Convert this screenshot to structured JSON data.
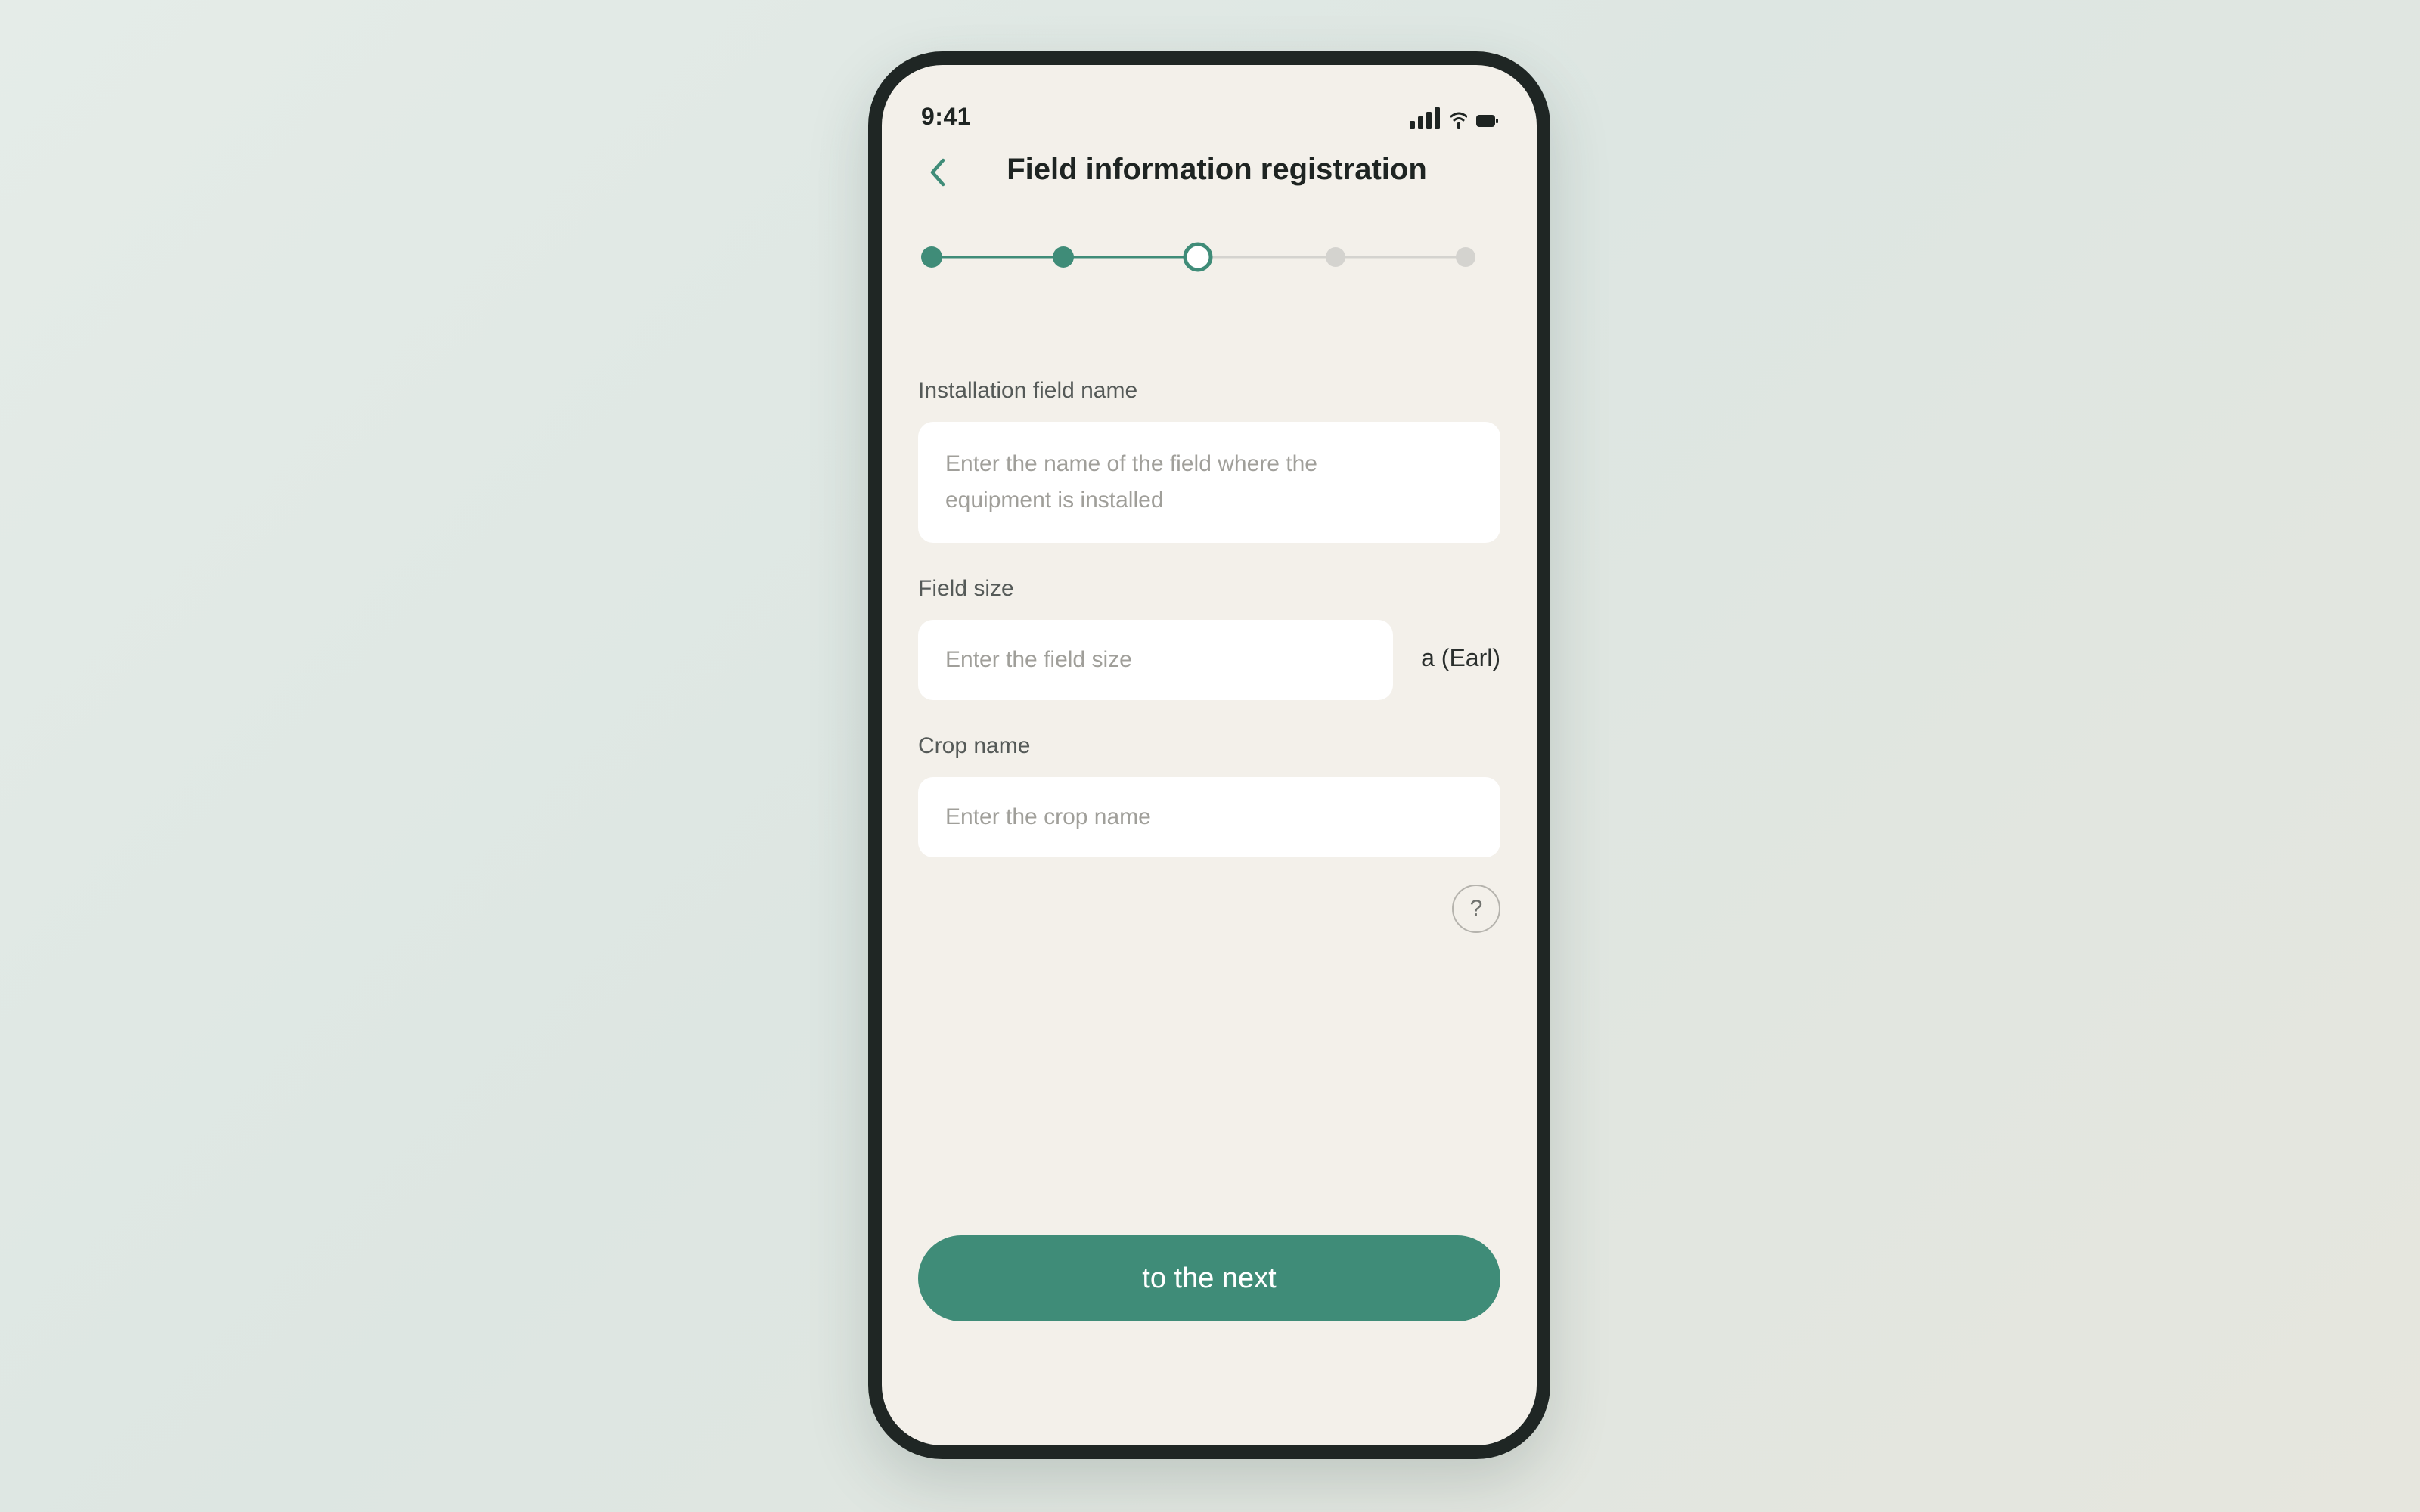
{
  "status_bar": {
    "time": "9:41",
    "icons": [
      "signal-icon",
      "wifi-icon",
      "battery-icon"
    ]
  },
  "header": {
    "back_icon": "chevron-left-icon",
    "title": "Field information registration"
  },
  "stepper": {
    "total_steps": 5,
    "current_step": 3,
    "completed_steps": 2
  },
  "form": {
    "field_name": {
      "label": "Installation field name",
      "placeholder": "Enter the name of the field where the equipment is installed",
      "value": ""
    },
    "field_size": {
      "label": "Field size",
      "placeholder": "Enter the field size",
      "value": "",
      "unit": "a (Earl)"
    },
    "crop_name": {
      "label": "Crop name",
      "placeholder": "Enter the crop name",
      "value": ""
    }
  },
  "help": {
    "label": "?"
  },
  "footer": {
    "next_label": "to the next"
  },
  "colors": {
    "accent": "#3f8c78",
    "background": "#f3f0ea",
    "inactive": "#d4d3cf",
    "text_primary": "#1e2422",
    "placeholder": "#a09f9a"
  }
}
